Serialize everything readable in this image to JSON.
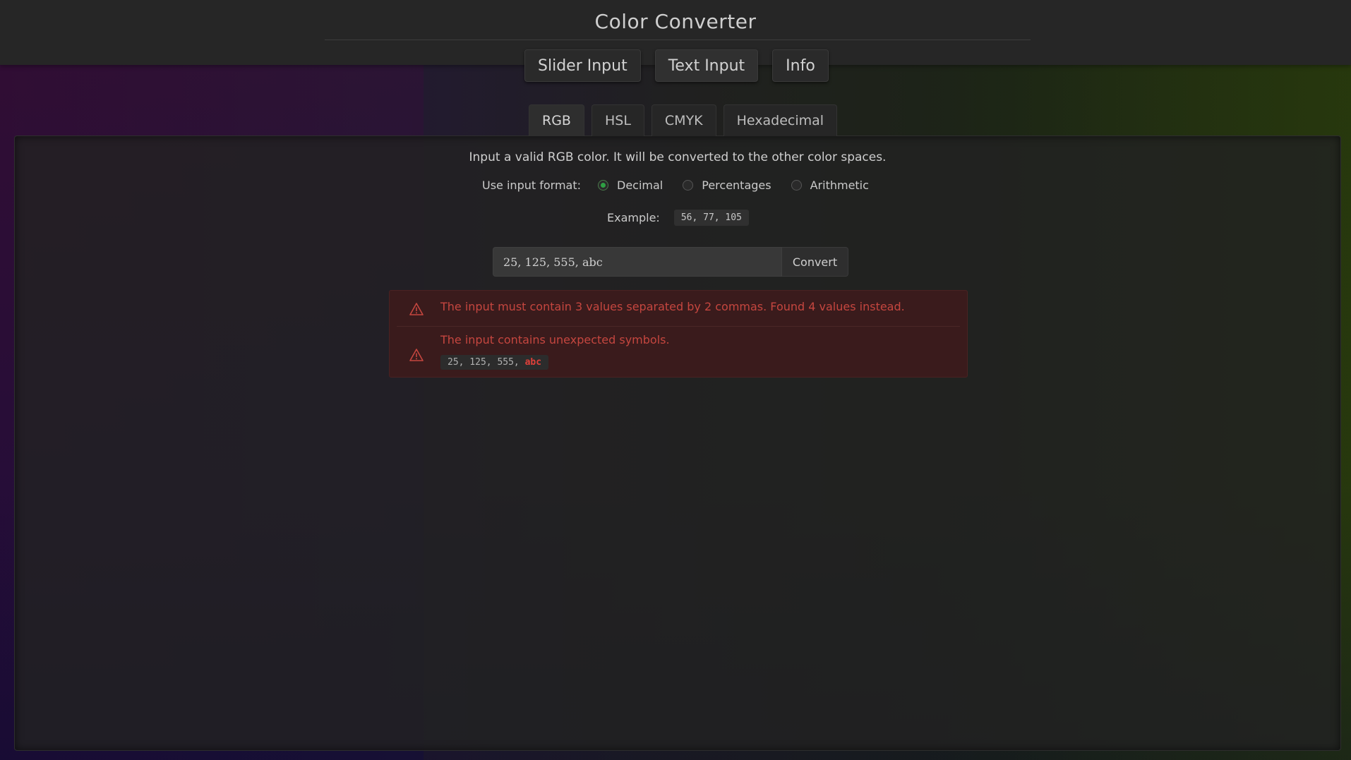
{
  "header": {
    "title": "Color Converter",
    "tabs": [
      {
        "label": "Slider Input"
      },
      {
        "label": "Text Input"
      },
      {
        "label": "Info"
      }
    ],
    "active_tab": "Text Input"
  },
  "color_spaces": {
    "tabs": [
      {
        "label": "RGB"
      },
      {
        "label": "HSL"
      },
      {
        "label": "CMYK"
      },
      {
        "label": "Hexadecimal"
      }
    ],
    "active": "RGB"
  },
  "form": {
    "description": "Input a valid RGB color. It will be converted to the other color spaces.",
    "format_label": "Use input format:",
    "formats": [
      {
        "label": "Decimal",
        "checked": true
      },
      {
        "label": "Percentages",
        "checked": false
      },
      {
        "label": "Arithmetic",
        "checked": false
      }
    ],
    "example_label": "Example:",
    "example_value": "56, 77, 105",
    "input_value": "25, 125, 555, abc",
    "convert_label": "Convert"
  },
  "errors": {
    "message_1": "The input must contain 3 values separated by 2 commas. Found 4 values instead.",
    "message_2": "The input contains unexpected symbols.",
    "code_prefix": "25, 125, 555, ",
    "code_bad": "abc"
  },
  "colors": {
    "accent_green": "#2ea043",
    "error_red": "#c5463f",
    "error_bg": "#3a1b1c"
  },
  "icons": {
    "warning": "warning-icon"
  }
}
